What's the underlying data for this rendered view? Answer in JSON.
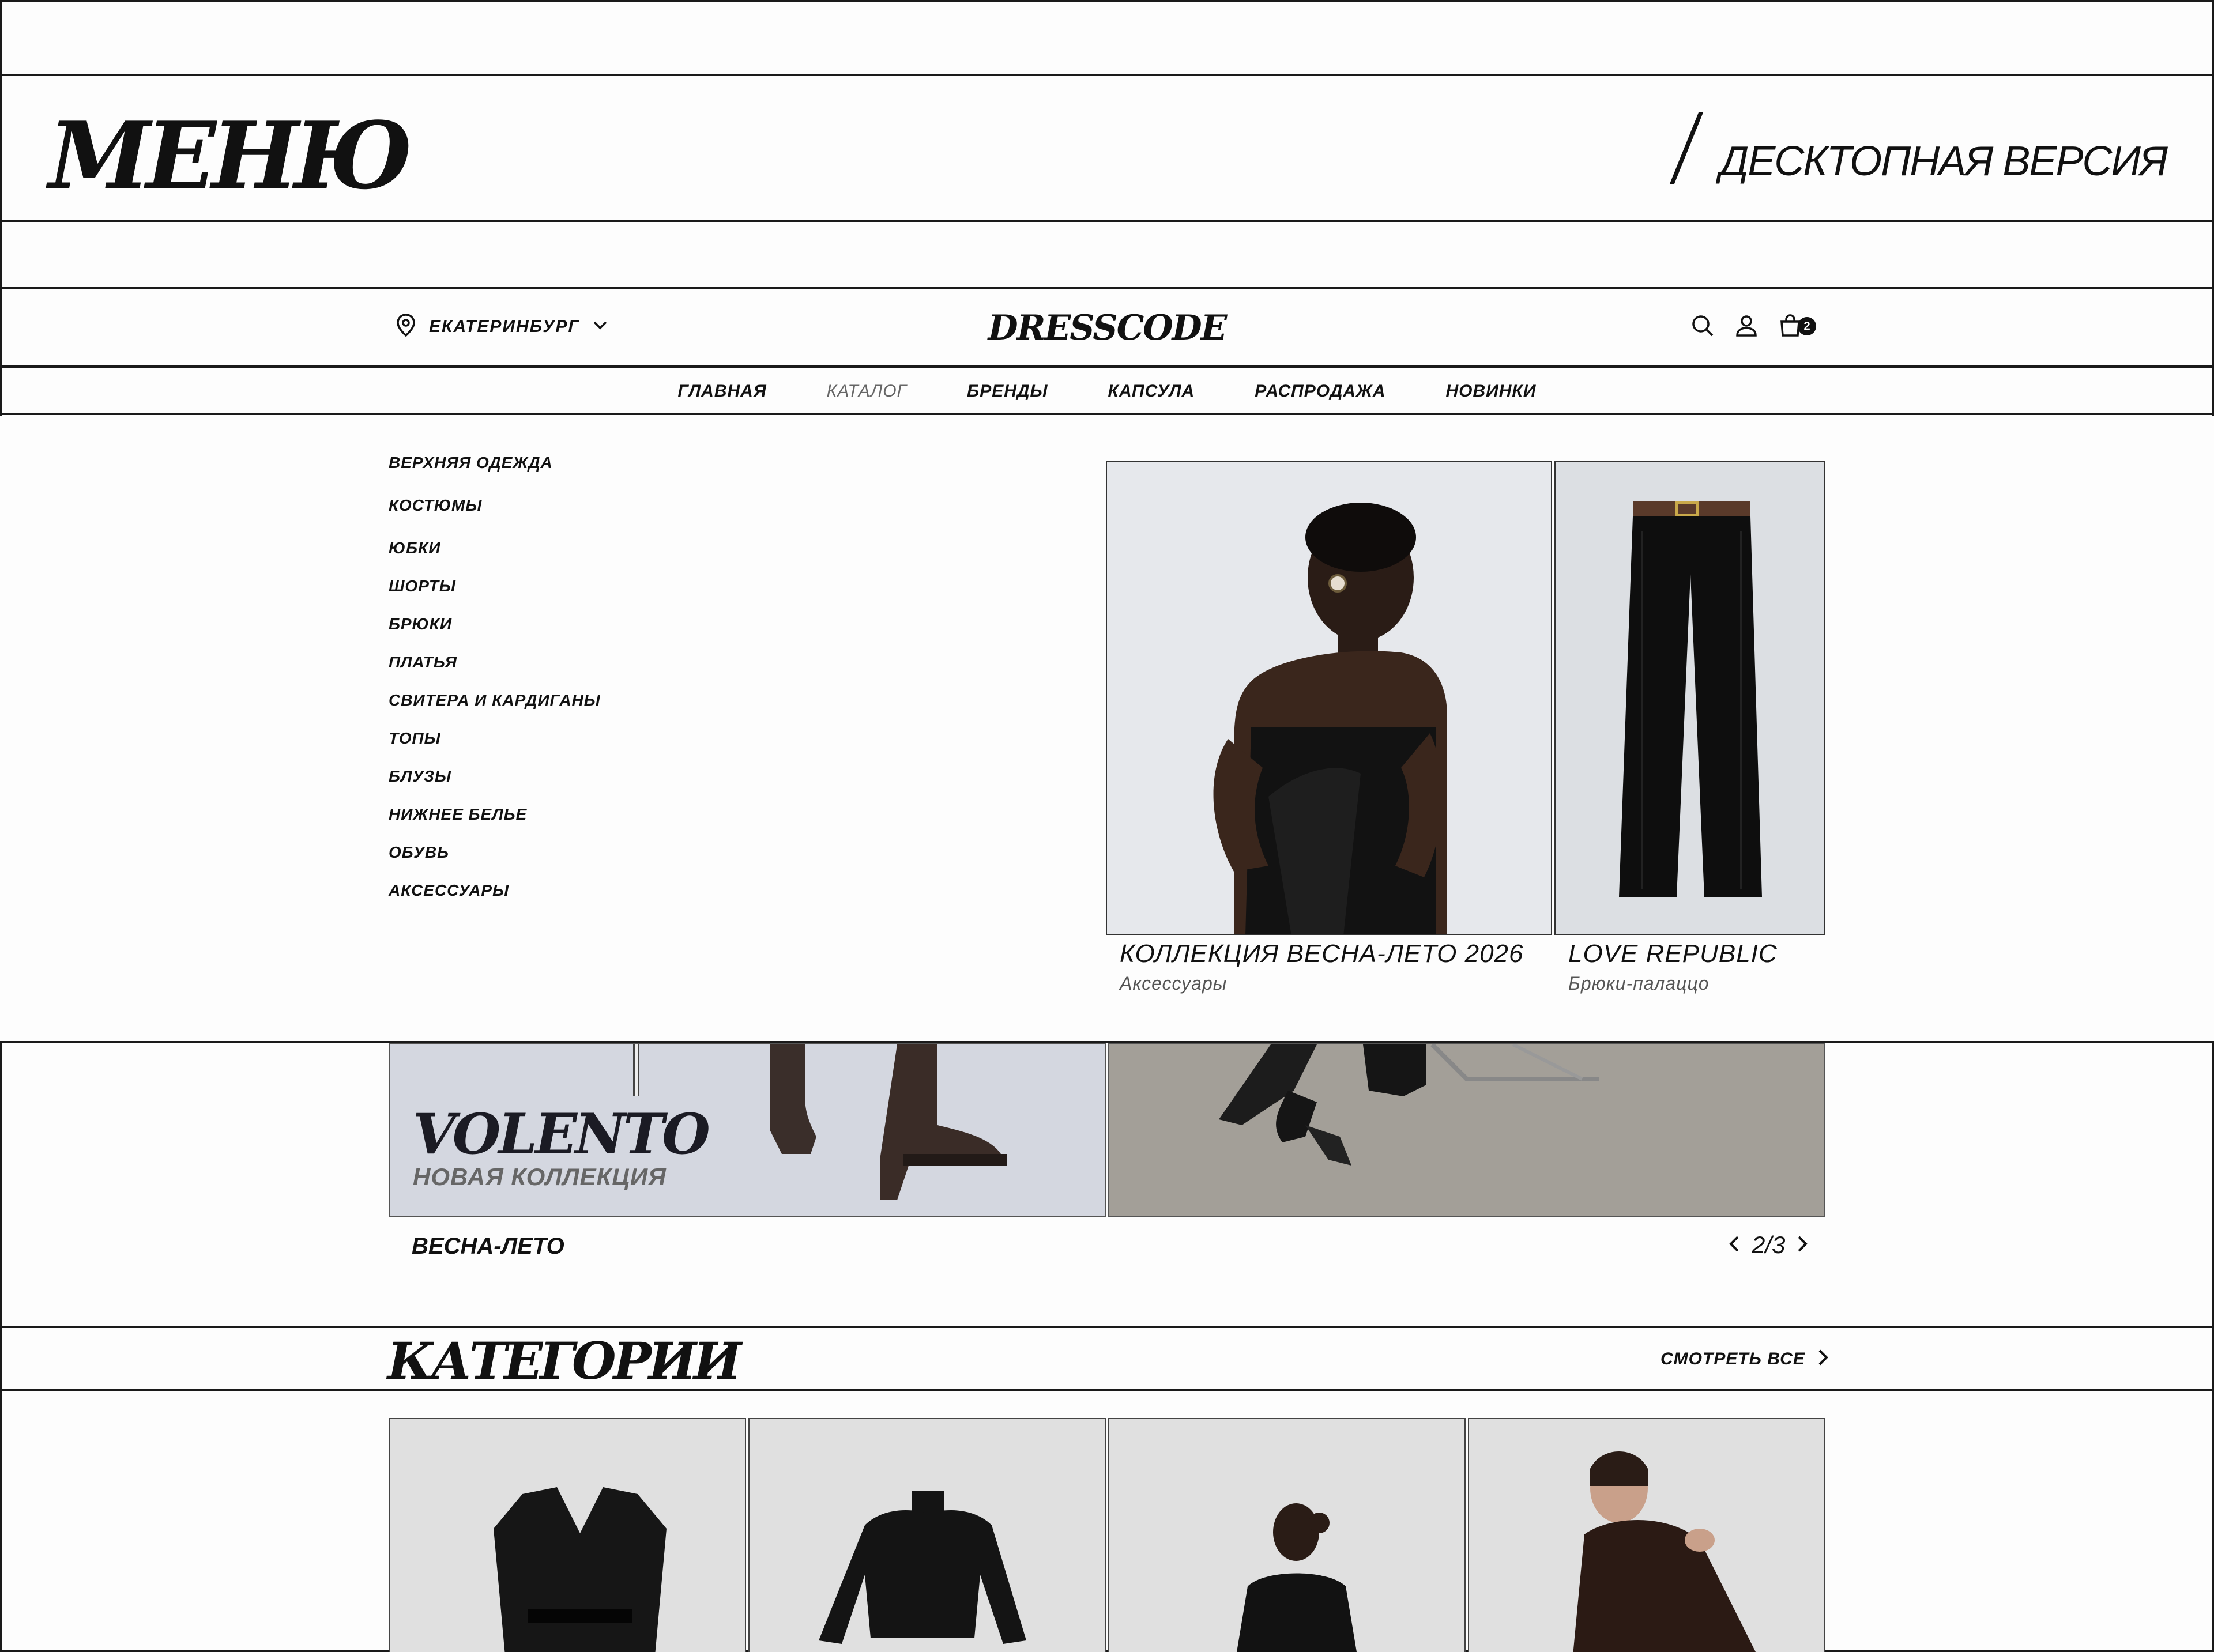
{
  "menu_header": {
    "title": "МЕНЮ",
    "version_label": "ДЕСКТОПНАЯ ВЕРСИЯ"
  },
  "site_header": {
    "city": "ЕКАТЕРИНБУРГ",
    "logo": "DRESSCODE",
    "cart_count": "2"
  },
  "nav": {
    "items": [
      "ГЛАВНАЯ",
      "КАТАЛОГ",
      "БРЕНДЫ",
      "КАПСУЛА",
      "РАСПРОДАЖА",
      "НОВИНКИ"
    ],
    "active": "КАТАЛОГ"
  },
  "catalog_menu": {
    "categories": [
      "ВЕРХНЯЯ ОДЕЖДА",
      "КОСТЮМЫ",
      "ЮБКИ",
      "ШОРТЫ",
      "БРЮКИ",
      "ПЛАТЬЯ",
      "СВИТЕРА И КАРДИГАНЫ",
      "ТОПЫ",
      "БЛУЗЫ",
      "НИЖНЕЕ БЕЛЬЕ",
      "ОБУВЬ",
      "АКСЕССУАРЫ"
    ],
    "promos": [
      {
        "title": "КОЛЛЕКЦИЯ ВЕСНА-ЛЕТО 2026",
        "subtitle": "Аксессуары"
      },
      {
        "title": "LOVE REPUBLIC",
        "subtitle": "Брюки-палаццо"
      }
    ]
  },
  "hero": {
    "brand": "VOLENTO",
    "brand_subtitle": "НОВАЯ КОЛЛЕКЦИЯ",
    "season": "ВЕСНА-ЛЕТО",
    "pager": "2/3"
  },
  "categories_section": {
    "title": "КАТЕГОРИИ",
    "see_all": "СМОТРЕТЬ ВСЕ"
  },
  "colors": {
    "ink": "#111111",
    "rule": "#1a1a1a",
    "muted": "#666666",
    "promo_bg": "#e7e9ec",
    "card_bg": "#e0e0e0"
  }
}
